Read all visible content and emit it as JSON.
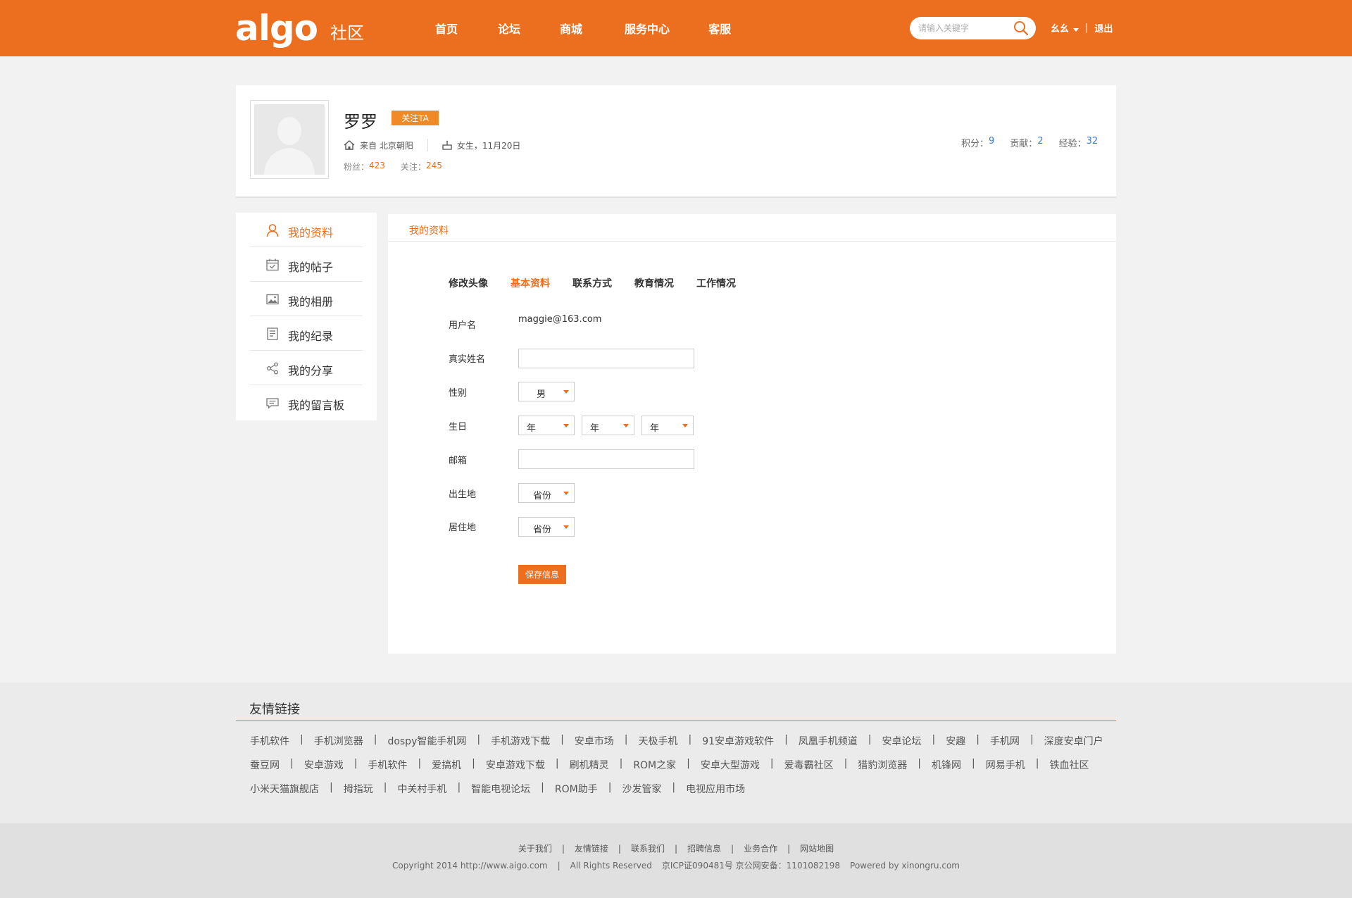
{
  "header": {
    "logo": "algo",
    "logo_sub": "社区",
    "nav": [
      "首页",
      "论坛",
      "商城",
      "服务中心",
      "客服"
    ],
    "search_placeholder": "请输入关键字",
    "username": "幺幺",
    "separator": "|",
    "logout": "退出",
    "accent": "#eb6f1f"
  },
  "profile": {
    "name": "罗罗",
    "follow_label": "关注TA",
    "location": "来自 北京朝阳",
    "birth": "女生，11月20日",
    "fans_label": "粉丝：",
    "fans": "423",
    "following_label": "关注：",
    "following": "245",
    "points_label": "积分：",
    "points": "9",
    "contribution_label": "贡献：",
    "contribution": "2",
    "experience_label": "经验：",
    "experience": "32"
  },
  "sidebar": {
    "items": [
      {
        "label": "我的资料",
        "icon": "user-icon",
        "active": true
      },
      {
        "label": "我的帖子",
        "icon": "calendar-icon",
        "active": false
      },
      {
        "label": "我的相册",
        "icon": "image-icon",
        "active": false
      },
      {
        "label": "我的纪录",
        "icon": "document-icon",
        "active": false
      },
      {
        "label": "我的分享",
        "icon": "share-icon",
        "active": false
      },
      {
        "label": "我的留言板",
        "icon": "message-icon",
        "active": false
      }
    ]
  },
  "main": {
    "panel_title": "我的资料",
    "tabs": [
      "修改头像",
      "基本资料",
      "联系方式",
      "教育情况",
      "工作情况"
    ],
    "active_tab": "基本资料",
    "form": {
      "username_label": "用户名",
      "username_value": "maggie@163.com",
      "realname_label": "真实姓名",
      "realname_value": "",
      "gender_label": "性别",
      "gender_value": "男",
      "birthday_label": "生日",
      "birthday_year": "年",
      "birthday_month": "年",
      "birthday_day": "年",
      "email_label": "邮箱",
      "email_value": "",
      "birthplace_label": "出生地",
      "birthplace_value": "省份",
      "residence_label": "居住地",
      "residence_value": "省份",
      "save_label": "保存信息"
    }
  },
  "friend_links": {
    "title": "友情链接",
    "rows": [
      [
        "手机软件",
        "手机浏览器",
        "dospy智能手机网",
        "手机游戏下载",
        "安卓市场",
        "天极手机",
        "91安卓游戏软件",
        "凤凰手机频道",
        "安卓论坛",
        "安趣",
        "手机网",
        "深度安卓门户"
      ],
      [
        "蚕豆网",
        "安卓游戏",
        "手机软件",
        "爱搞机",
        "安卓游戏下载",
        "刷机精灵",
        "ROM之家",
        "安卓大型游戏",
        "爱毒霸社区",
        "猎豹浏览器",
        "机锋网",
        "网易手机",
        "铁血社区"
      ],
      [
        "小米天猫旗舰店",
        "拇指玩",
        "中关村手机",
        "智能电视论坛",
        "ROM助手",
        "沙发管家",
        "电视应用市场"
      ]
    ],
    "separator": "|"
  },
  "footer": {
    "links": [
      "关于我们",
      "友情链接",
      "联系我们",
      "招聘信息",
      "业务合作",
      "网站地图"
    ],
    "separator": "|",
    "copyright": "Copyright 2014 http://www.aigo.com",
    "rights": "All Rights Reserved",
    "icp": "京ICP证090481号 京公网安备：1101082198",
    "powered": "Powered by xinongru.com"
  }
}
